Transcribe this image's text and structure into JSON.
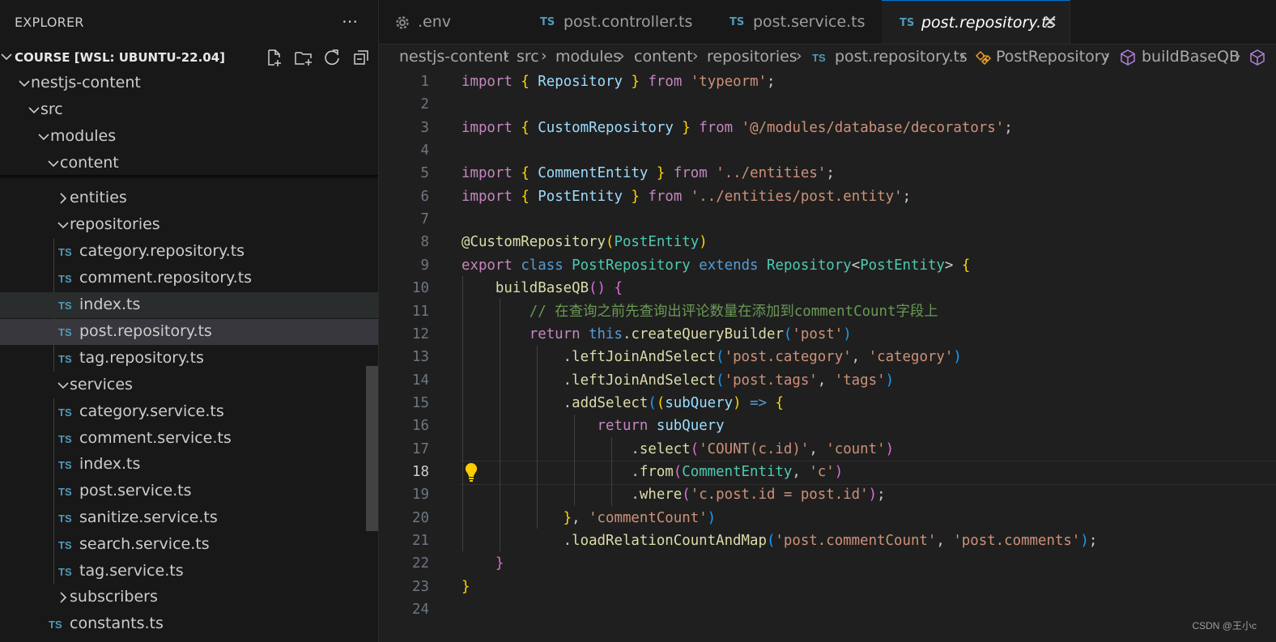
{
  "explorer": {
    "title": "EXPLORER",
    "workspace": "COURSE [WSL: UBUNTU-22.04]",
    "tree": [
      {
        "label": "nestjs-content",
        "type": "folder",
        "open": true,
        "level": 1,
        "chev": 22,
        "text": 38
      },
      {
        "label": "src",
        "type": "folder",
        "open": true,
        "level": 2,
        "chev": 34,
        "text": 50
      },
      {
        "label": "modules",
        "type": "folder",
        "open": true,
        "level": 3,
        "chev": 46,
        "text": 62
      },
      {
        "label": "content",
        "type": "folder",
        "open": true,
        "level": 4,
        "chev": 58,
        "text": 74
      },
      {
        "label": "entities",
        "type": "folder",
        "open": false,
        "chev": 70,
        "text": 86
      },
      {
        "label": "repositories",
        "type": "folder",
        "open": true,
        "chev": 70,
        "text": 86
      },
      {
        "label": "category.repository.ts",
        "type": "ts",
        "ts": 72,
        "text": 98
      },
      {
        "label": "comment.repository.ts",
        "type": "ts",
        "ts": 72,
        "text": 98
      },
      {
        "label": "index.ts",
        "type": "ts",
        "ts": 72,
        "text": 98,
        "state": "hover"
      },
      {
        "label": "post.repository.ts",
        "type": "ts",
        "ts": 72,
        "text": 98,
        "state": "selected"
      },
      {
        "label": "tag.repository.ts",
        "type": "ts",
        "ts": 72,
        "text": 98
      },
      {
        "label": "services",
        "type": "folder",
        "open": true,
        "chev": 70,
        "text": 86
      },
      {
        "label": "category.service.ts",
        "type": "ts",
        "ts": 72,
        "text": 98
      },
      {
        "label": "comment.service.ts",
        "type": "ts",
        "ts": 72,
        "text": 98
      },
      {
        "label": "index.ts",
        "type": "ts",
        "ts": 72,
        "text": 98
      },
      {
        "label": "post.service.ts",
        "type": "ts",
        "ts": 72,
        "text": 98
      },
      {
        "label": "sanitize.service.ts",
        "type": "ts",
        "ts": 72,
        "text": 98
      },
      {
        "label": "search.service.ts",
        "type": "ts",
        "ts": 72,
        "text": 98
      },
      {
        "label": "tag.service.ts",
        "type": "ts",
        "ts": 72,
        "text": 98
      },
      {
        "label": "subscribers",
        "type": "folder",
        "open": false,
        "chev": 70,
        "text": 86
      },
      {
        "label": "constants.ts",
        "type": "ts",
        "ts": 60,
        "text": 86
      }
    ]
  },
  "tabs": [
    {
      "label": ".env",
      "icon": "gear",
      "active": false
    },
    {
      "label": "post.controller.ts",
      "icon": "ts",
      "active": false
    },
    {
      "label": "post.service.ts",
      "icon": "ts",
      "active": false
    },
    {
      "label": "post.repository.ts",
      "icon": "ts",
      "active": true
    }
  ],
  "ts_badge": "TS",
  "breadcrumb": [
    "nestjs-content",
    "src",
    "modules",
    "content",
    "repositories",
    "post.repository.ts",
    "PostRepository",
    "buildBaseQB"
  ],
  "editor": {
    "current_line": 18,
    "lines": [
      [
        [
          "kw",
          "import"
        ],
        [
          "pun",
          " "
        ],
        [
          "b1",
          "{"
        ],
        [
          "pun",
          " "
        ],
        [
          "var",
          "Repository"
        ],
        [
          "pun",
          " "
        ],
        [
          "b1",
          "}"
        ],
        [
          "pun",
          " "
        ],
        [
          "kw",
          "from"
        ],
        [
          "pun",
          " "
        ],
        [
          "str",
          "'typeorm'"
        ],
        [
          "pun",
          ";"
        ]
      ],
      [],
      [
        [
          "kw",
          "import"
        ],
        [
          "pun",
          " "
        ],
        [
          "b1",
          "{"
        ],
        [
          "pun",
          " "
        ],
        [
          "var",
          "CustomRepository"
        ],
        [
          "pun",
          " "
        ],
        [
          "b1",
          "}"
        ],
        [
          "pun",
          " "
        ],
        [
          "kw",
          "from"
        ],
        [
          "pun",
          " "
        ],
        [
          "str",
          "'@/modules/database/decorators'"
        ],
        [
          "pun",
          ";"
        ]
      ],
      [],
      [
        [
          "kw",
          "import"
        ],
        [
          "pun",
          " "
        ],
        [
          "b1",
          "{"
        ],
        [
          "pun",
          " "
        ],
        [
          "var",
          "CommentEntity"
        ],
        [
          "pun",
          " "
        ],
        [
          "b1",
          "}"
        ],
        [
          "pun",
          " "
        ],
        [
          "kw",
          "from"
        ],
        [
          "pun",
          " "
        ],
        [
          "str",
          "'../entities'"
        ],
        [
          "pun",
          ";"
        ]
      ],
      [
        [
          "kw",
          "import"
        ],
        [
          "pun",
          " "
        ],
        [
          "b1",
          "{"
        ],
        [
          "pun",
          " "
        ],
        [
          "var",
          "PostEntity"
        ],
        [
          "pun",
          " "
        ],
        [
          "b1",
          "}"
        ],
        [
          "pun",
          " "
        ],
        [
          "kw",
          "from"
        ],
        [
          "pun",
          " "
        ],
        [
          "str",
          "'../entities/post.entity'"
        ],
        [
          "pun",
          ";"
        ]
      ],
      [],
      [
        [
          "dec",
          "@CustomRepository"
        ],
        [
          "b1",
          "("
        ],
        [
          "cls",
          "PostEntity"
        ],
        [
          "b1",
          ")"
        ]
      ],
      [
        [
          "kw",
          "export"
        ],
        [
          "pun",
          " "
        ],
        [
          "kw2",
          "class"
        ],
        [
          "pun",
          " "
        ],
        [
          "cls",
          "PostRepository"
        ],
        [
          "pun",
          " "
        ],
        [
          "kw2",
          "extends"
        ],
        [
          "pun",
          " "
        ],
        [
          "cls",
          "Repository"
        ],
        [
          "pun",
          "<"
        ],
        [
          "cls",
          "PostEntity"
        ],
        [
          "pun",
          "> "
        ],
        [
          "b1",
          "{"
        ]
      ],
      [
        [
          "pun",
          "    "
        ],
        [
          "fn",
          "buildBaseQB"
        ],
        [
          "b2",
          "()"
        ],
        [
          "pun",
          " "
        ],
        [
          "b2",
          "{"
        ]
      ],
      [
        [
          "pun",
          "        "
        ],
        [
          "cmt",
          "// 在查询之前先查询出评论数量在添加到commentCount字段上"
        ]
      ],
      [
        [
          "pun",
          "        "
        ],
        [
          "kw",
          "return"
        ],
        [
          "pun",
          " "
        ],
        [
          "kw2",
          "this"
        ],
        [
          "pun",
          "."
        ],
        [
          "fn",
          "createQueryBuilder"
        ],
        [
          "b3",
          "("
        ],
        [
          "str",
          "'post'"
        ],
        [
          "b3",
          ")"
        ]
      ],
      [
        [
          "pun",
          "            ."
        ],
        [
          "fn",
          "leftJoinAndSelect"
        ],
        [
          "b3",
          "("
        ],
        [
          "str",
          "'post.category'"
        ],
        [
          "pun",
          ", "
        ],
        [
          "str",
          "'category'"
        ],
        [
          "b3",
          ")"
        ]
      ],
      [
        [
          "pun",
          "            ."
        ],
        [
          "fn",
          "leftJoinAndSelect"
        ],
        [
          "b3",
          "("
        ],
        [
          "str",
          "'post.tags'"
        ],
        [
          "pun",
          ", "
        ],
        [
          "str",
          "'tags'"
        ],
        [
          "b3",
          ")"
        ]
      ],
      [
        [
          "pun",
          "            ."
        ],
        [
          "fn",
          "addSelect"
        ],
        [
          "b3",
          "("
        ],
        [
          "b1",
          "("
        ],
        [
          "var",
          "subQuery"
        ],
        [
          "b1",
          ")"
        ],
        [
          "pun",
          " "
        ],
        [
          "kw2",
          "=>"
        ],
        [
          "pun",
          " "
        ],
        [
          "b1",
          "{"
        ]
      ],
      [
        [
          "pun",
          "                "
        ],
        [
          "kw",
          "return"
        ],
        [
          "pun",
          " "
        ],
        [
          "var",
          "subQuery"
        ]
      ],
      [
        [
          "pun",
          "                    ."
        ],
        [
          "fn",
          "select"
        ],
        [
          "b2",
          "("
        ],
        [
          "str",
          "'COUNT(c.id)'"
        ],
        [
          "pun",
          ", "
        ],
        [
          "str",
          "'count'"
        ],
        [
          "b2",
          ")"
        ]
      ],
      [
        [
          "pun",
          "                    ."
        ],
        [
          "fn",
          "from"
        ],
        [
          "b2",
          "("
        ],
        [
          "cls",
          "CommentEntity"
        ],
        [
          "pun",
          ", "
        ],
        [
          "str",
          "'c'"
        ],
        [
          "b2",
          ")"
        ]
      ],
      [
        [
          "pun",
          "                    ."
        ],
        [
          "fn",
          "where"
        ],
        [
          "b2",
          "("
        ],
        [
          "str",
          "'c.post.id = post.id'"
        ],
        [
          "b2",
          ")"
        ],
        [
          "pun",
          ";"
        ]
      ],
      [
        [
          "pun",
          "            "
        ],
        [
          "b1",
          "}"
        ],
        [
          "pun",
          ", "
        ],
        [
          "str",
          "'commentCount'"
        ],
        [
          "b3",
          ")"
        ]
      ],
      [
        [
          "pun",
          "            ."
        ],
        [
          "fn",
          "loadRelationCountAndMap"
        ],
        [
          "b3",
          "("
        ],
        [
          "str",
          "'post.commentCount'"
        ],
        [
          "pun",
          ", "
        ],
        [
          "str",
          "'post.comments'"
        ],
        [
          "b3",
          ")"
        ],
        [
          "pun",
          ";"
        ]
      ],
      [
        [
          "pun",
          "    "
        ],
        [
          "b2",
          "}"
        ]
      ],
      [
        [
          "b1",
          "}"
        ]
      ],
      []
    ]
  },
  "watermark": "CSDN @王小c",
  "colors": {
    "accent": "#0078d4",
    "ts_icon": "#519aba",
    "selected_row": "#37373d"
  }
}
